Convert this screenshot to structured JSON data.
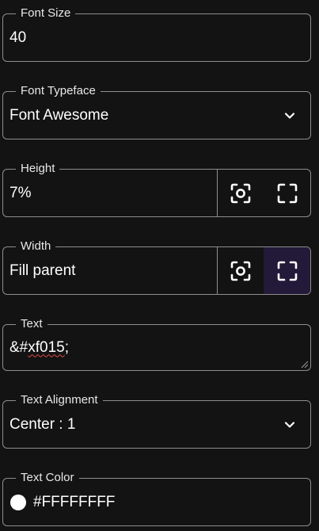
{
  "font_size": {
    "label": "Font Size",
    "value": "40"
  },
  "font_typeface": {
    "label": "Font Typeface",
    "value": "Font Awesome",
    "icon": "chevron-down-icon"
  },
  "height": {
    "label": "Height",
    "value": "7%",
    "icon_target": "focus-target-icon",
    "icon_fill": "fullscreen-icon"
  },
  "width": {
    "label": "Width",
    "value": "Fill parent",
    "icon_target": "focus-target-icon",
    "icon_fill": "fullscreen-icon",
    "active": "fill"
  },
  "text": {
    "label": "Text",
    "value_prefix": "&#",
    "value_flagged": "xf015",
    "value_suffix": ";"
  },
  "text_alignment": {
    "label": "Text Alignment",
    "value": "Center : 1",
    "icon": "chevron-down-icon"
  },
  "text_color": {
    "label": "Text Color",
    "value": "#FFFFFFFF",
    "swatch": "#FFFFFF"
  },
  "colors": {
    "background": "#131313",
    "border": "#8e8e8e",
    "active_button": "#231a3a",
    "spellcheck": "#e04848"
  }
}
